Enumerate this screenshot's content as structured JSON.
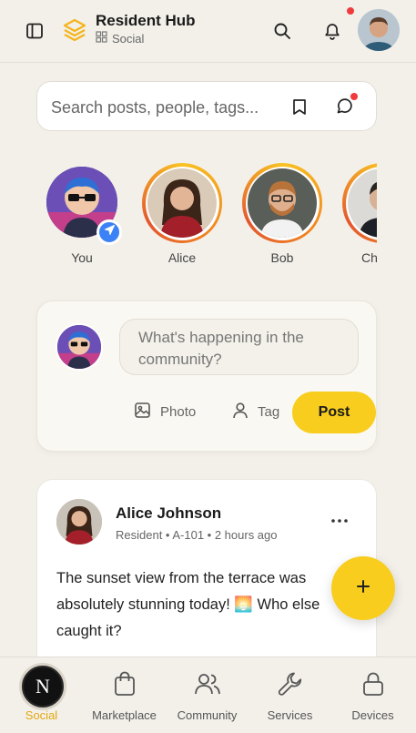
{
  "header": {
    "brand_title": "Resident Hub",
    "brand_subtitle": "Social",
    "icons": [
      "sidebar-toggle-icon",
      "layers-logo-icon",
      "grid-icon",
      "search-icon",
      "bell-icon",
      "avatar"
    ]
  },
  "search": {
    "placeholder": "Search posts, people, tags...",
    "icons": [
      "bookmark-icon",
      "message-icon"
    ]
  },
  "stories": [
    {
      "name": "You",
      "is_self": true
    },
    {
      "name": "Alice"
    },
    {
      "name": "Bob"
    },
    {
      "name": "Ch"
    }
  ],
  "composer": {
    "placeholder": "What's happening in the community?",
    "photo_label": "Photo",
    "tag_label": "Tag",
    "post_label": "Post"
  },
  "post": {
    "author": "Alice Johnson",
    "meta": "Resident • A-101 • 2 hours ago",
    "text": "The sunset view from the terrace was absolutely stunning today! 🌅 Who else caught it?"
  },
  "fab": {
    "icon": "plus-icon"
  },
  "bottom_nav": {
    "items": [
      {
        "label": "Social",
        "icon": "n-logo",
        "active": true
      },
      {
        "label": "Marketplace",
        "icon": "shopping-bag-icon"
      },
      {
        "label": "Community",
        "icon": "users-icon"
      },
      {
        "label": "Services",
        "icon": "wrench-icon"
      },
      {
        "label": "Devices",
        "icon": "lock-icon"
      }
    ],
    "badge_letter": "N"
  },
  "colors": {
    "accent": "#f8cd1e",
    "background": "#f3f0ea",
    "notification": "#ef3b3b",
    "story_badge": "#3b82f6"
  }
}
